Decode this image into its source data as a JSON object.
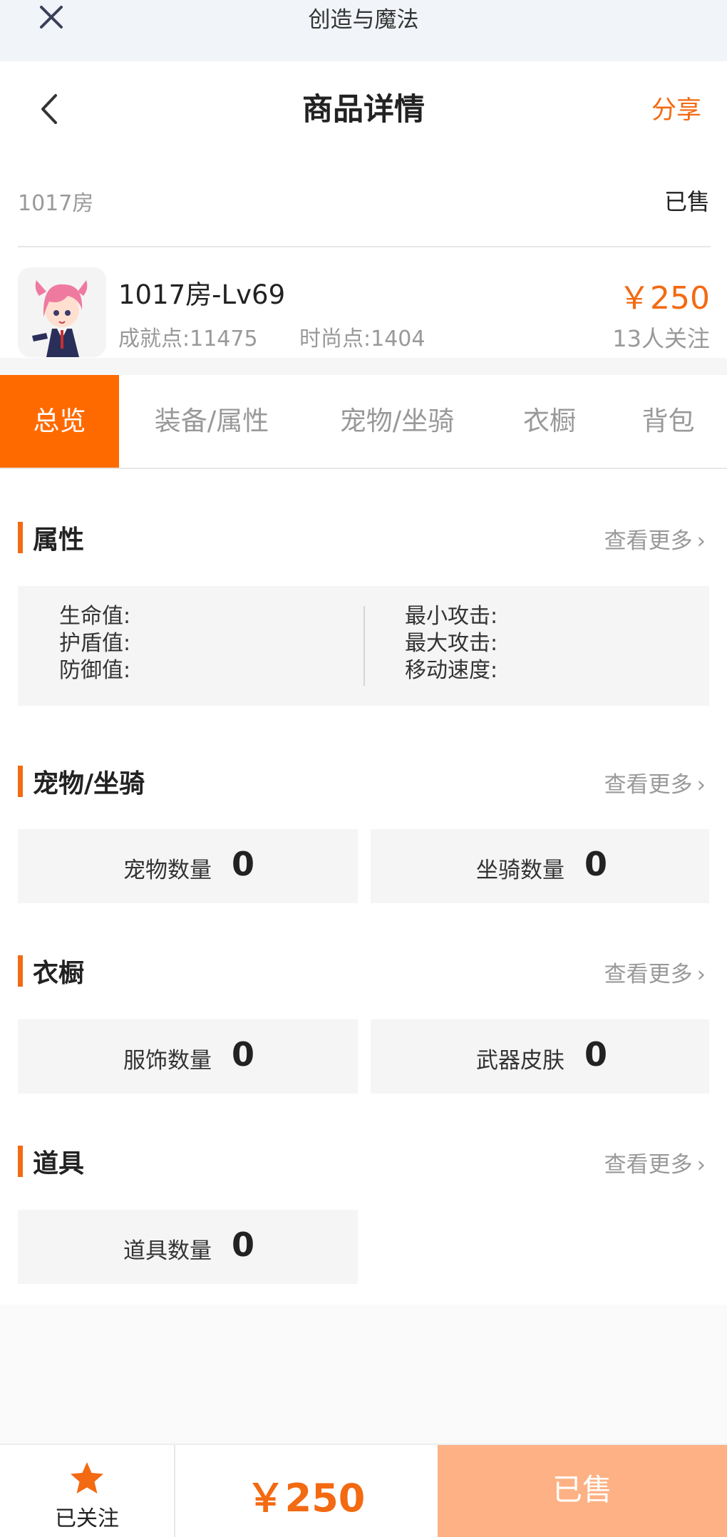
{
  "system": {
    "title": "创造与魔法"
  },
  "header": {
    "title": "商品详情",
    "share_label": "分享"
  },
  "listing": {
    "room": "1017房",
    "status": "已售",
    "name": "1017房-Lv69",
    "achievement": "成就点:11475",
    "fashion": "时尚点:1404",
    "price": "￥250",
    "followers": "13人关注"
  },
  "tabs": [
    {
      "label": "总览"
    },
    {
      "label": "装备/属性"
    },
    {
      "label": "宠物/坐骑"
    },
    {
      "label": "衣橱"
    },
    {
      "label": "背包"
    }
  ],
  "more_label": "查看更多",
  "attributes": {
    "title": "属性",
    "left": [
      "生命值:",
      "护盾值:",
      "防御值:"
    ],
    "right": [
      "最小攻击:",
      "最大攻击:",
      "移动速度:"
    ]
  },
  "pets": {
    "title": "宠物/坐骑",
    "items": [
      {
        "label": "宠物数量",
        "value": "0"
      },
      {
        "label": "坐骑数量",
        "value": "0"
      }
    ]
  },
  "wardrobe": {
    "title": "衣橱",
    "items": [
      {
        "label": "服饰数量",
        "value": "0"
      },
      {
        "label": "武器皮肤",
        "value": "0"
      }
    ]
  },
  "props": {
    "title": "道具",
    "items": [
      {
        "label": "道具数量",
        "value": "0"
      }
    ]
  },
  "bottom": {
    "follow_label": "已关注",
    "price": "￥250",
    "sold_label": "已售"
  },
  "colors": {
    "accent": "#f36a12",
    "tab_active": "#ff6a00",
    "sold_button": "#fdb184"
  },
  "icons": {
    "close": "close-icon",
    "back": "chevron-left-icon",
    "more": "chevron-right-icon",
    "follow": "star-icon"
  }
}
